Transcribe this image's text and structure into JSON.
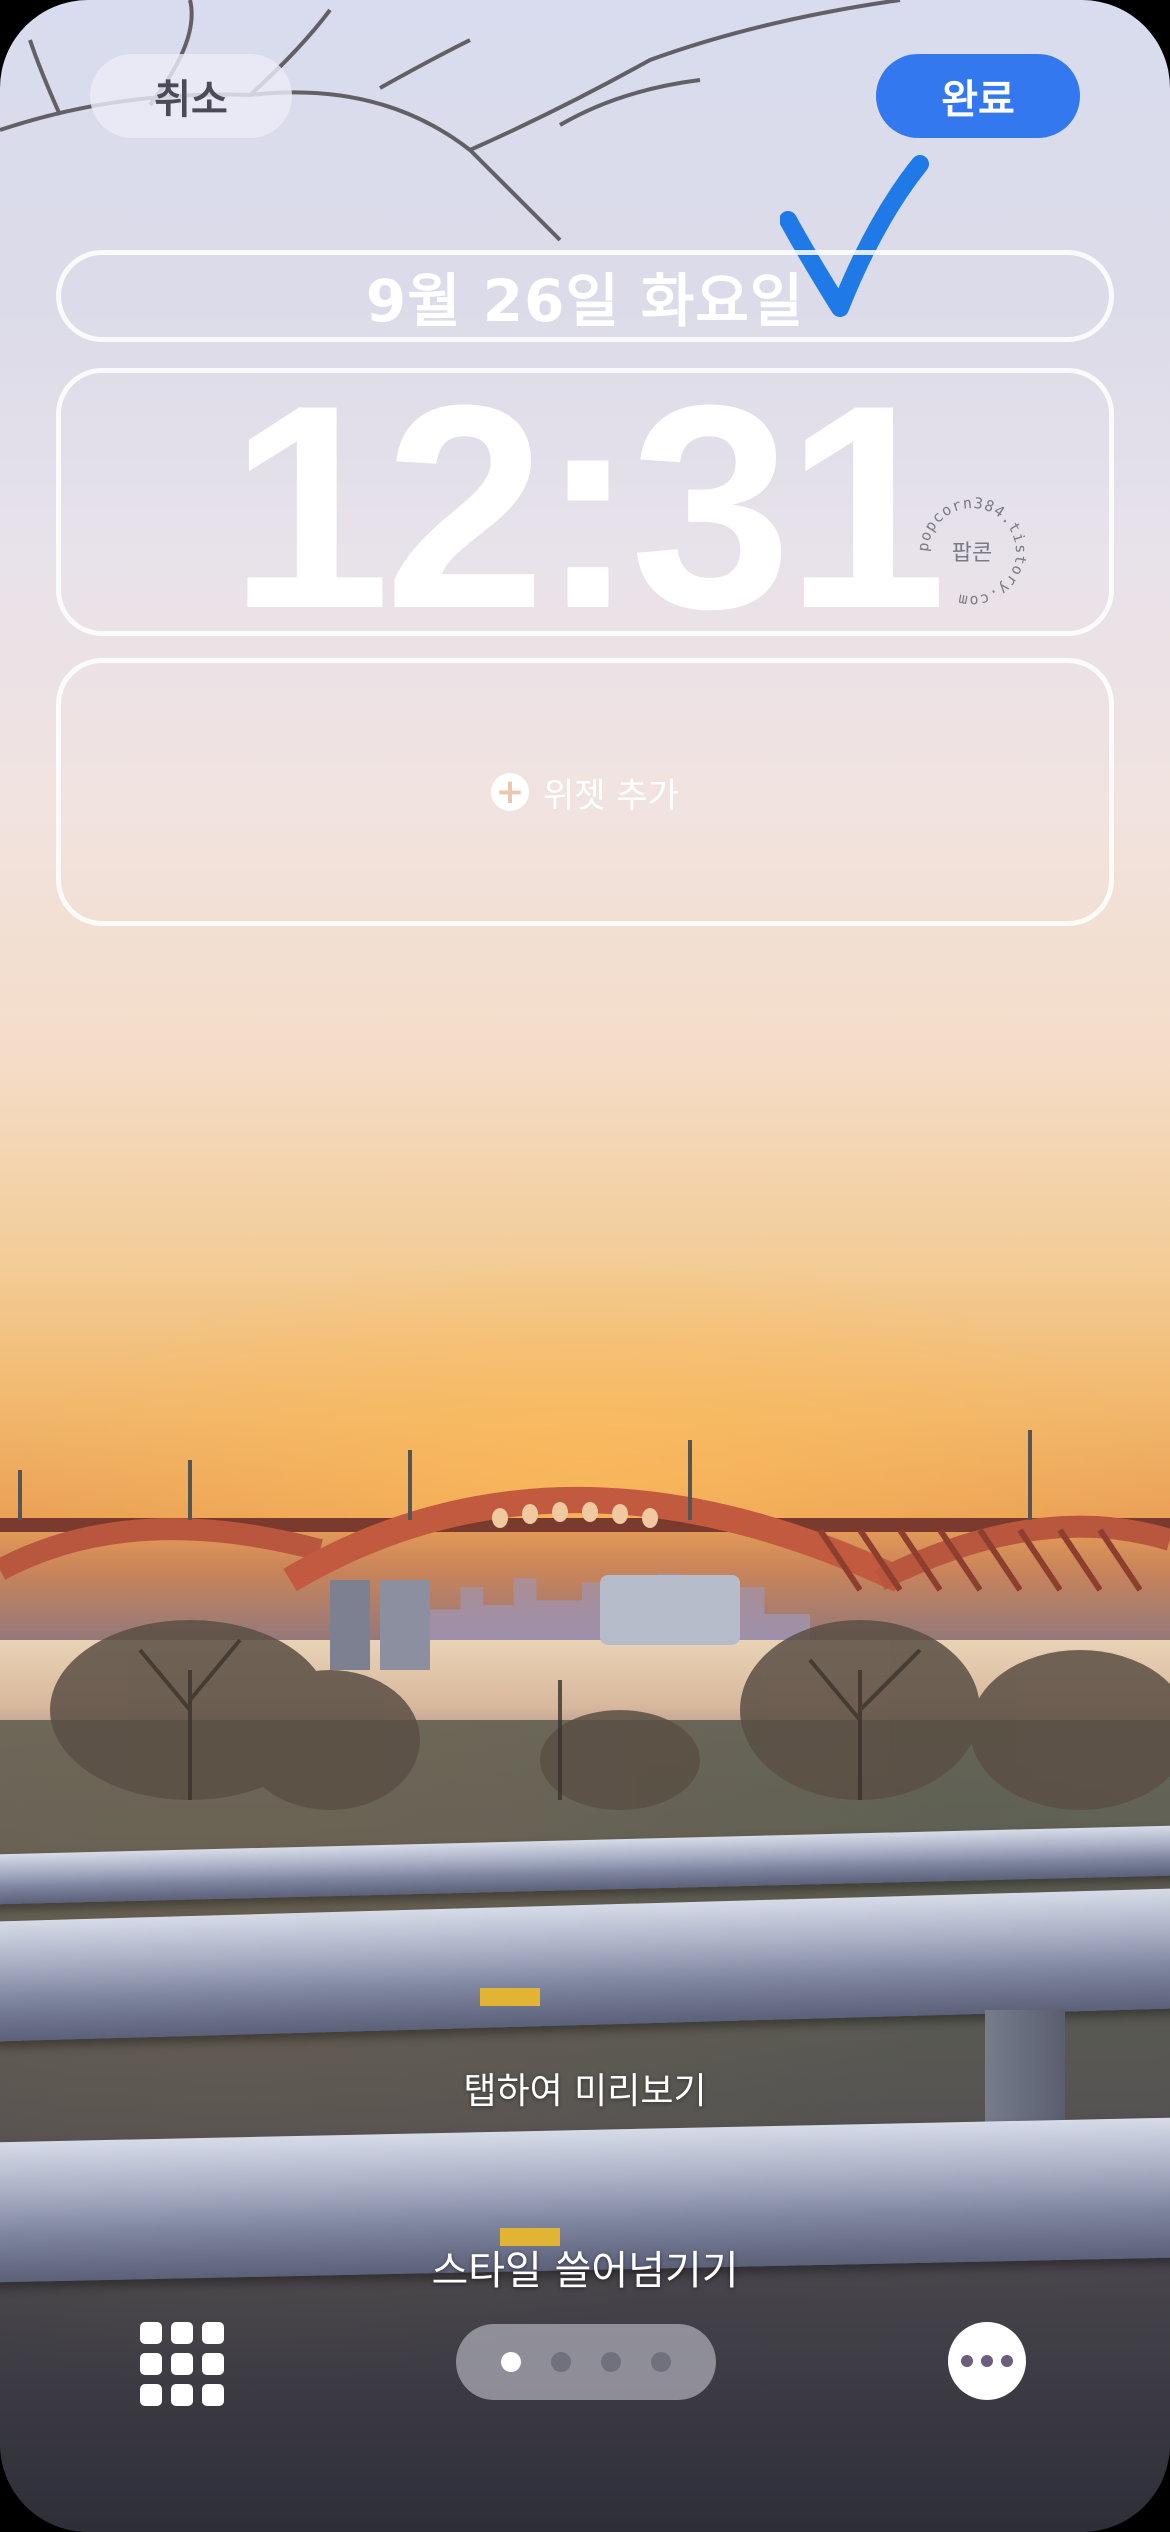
{
  "top_bar": {
    "cancel_label": "취소",
    "done_label": "완료"
  },
  "lock_screen": {
    "date": "9월 26일 화요일",
    "time": "12:31",
    "add_widget_label": "위젯 추가",
    "stamp_text": "popcorn384.tistory.com",
    "stamp_center": "팝콘"
  },
  "hints": {
    "tap_preview": "탭하여 미리보기",
    "swipe_styles": "스타일 쓸어넘기기"
  },
  "pager": {
    "page_count": 4,
    "active_index": 0
  },
  "icons": {
    "gallery": "photo-grid-icon",
    "more": "ellipsis-icon",
    "annotation": "checkmark-icon"
  },
  "colors": {
    "done_button": "#3478f0",
    "annotation_check": "#1f7ae8"
  }
}
